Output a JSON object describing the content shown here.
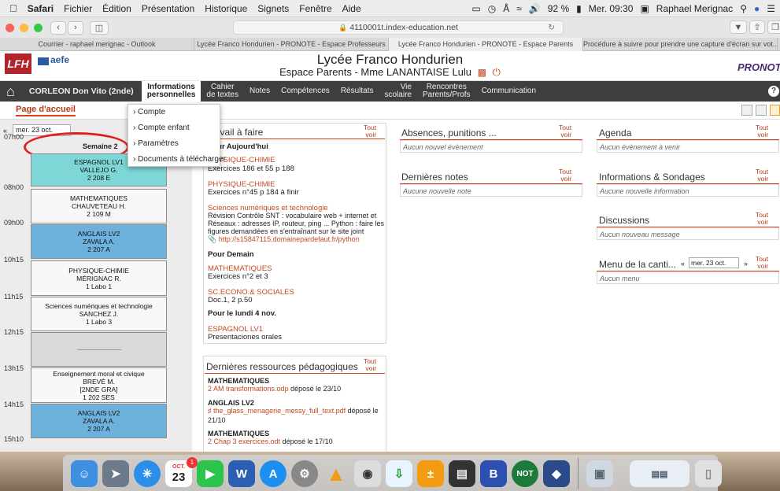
{
  "menubar": {
    "items": [
      "Safari",
      "Fichier",
      "Édition",
      "Présentation",
      "Historique",
      "Signets",
      "Fenêtre",
      "Aide"
    ],
    "battery": "92 %",
    "clock": "Mer. 09:30",
    "user": "Raphael Merignac"
  },
  "browser": {
    "url": "4110001t.index-education.net",
    "tabs": [
      "Courrier - raphael merignac - Outlook",
      "Lycée Franco Hondurien - PRONOTE - Espace Professeurs",
      "Lycée Franco Hondurien - PRONOTE - Espace Parents",
      "Procédure à suivre pour prendre une capture d'écran sur vot..."
    ]
  },
  "header": {
    "school": "Lycée Franco Hondurien",
    "space": "Espace Parents - Mme LANANTAISE Lulu",
    "logo_text": "aefe",
    "brand": "PRONOTE"
  },
  "nav": {
    "student": "CORLEON Don Vito (2nde)",
    "items": [
      [
        "Informations",
        "personnelles"
      ],
      [
        "Cahier",
        "de textes"
      ],
      [
        "Notes",
        ""
      ],
      [
        "Compétences",
        ""
      ],
      [
        "Résultats",
        ""
      ],
      [
        "Vie",
        "scolaire"
      ],
      [
        "Rencontres",
        "Parents/Profs"
      ],
      [
        "Communication",
        ""
      ]
    ]
  },
  "page_tab": "Page d'accueil",
  "dropdown": [
    "Compte",
    "Compte enfant",
    "Paramètres",
    "Documents à télécharger"
  ],
  "schedule": {
    "date": "mer. 23 oct.",
    "week": "Semaine 2",
    "times": [
      "07h00",
      "08h00",
      "09h00",
      "10h15",
      "11h15",
      "12h15",
      "13h15",
      "14h15",
      "15h10"
    ],
    "courses": [
      {
        "l1": "ESPAGNOL LV1",
        "l2": "VALLEJO G.",
        "l3": "2 208 E",
        "l4": "",
        "color": "teal"
      },
      {
        "l1": "MATHEMATIQUES",
        "l2": "CHAUVETEAU H.",
        "l3": "2 109 M",
        "l4": "",
        "color": "white"
      },
      {
        "l1": "ANGLAIS LV2",
        "l2": "ZAVALA A.",
        "l3": "2 207 A",
        "l4": "",
        "color": "blue"
      },
      {
        "l1": "PHYSIQUE-CHIMIE",
        "l2": "MÉRIGNAC R.",
        "l3": "1 Labo 1",
        "l4": "",
        "color": "white"
      },
      {
        "l1": "Sciences numériques et technologie",
        "l2": "SANCHEZ J.",
        "l3": "1 Labo 3",
        "l4": "",
        "color": "white"
      },
      {
        "l1": "Enseignement moral et civique",
        "l2": "BREVÉ M.",
        "l3": "[2NDE GRA]",
        "l4": "1 202 SES",
        "color": "white"
      },
      {
        "l1": "ANGLAIS LV2",
        "l2": "ZAVALA A.",
        "l3": "2 207 A",
        "l4": "",
        "color": "blue"
      }
    ]
  },
  "travail": {
    "title": "Travail à faire",
    "tout": [
      "Tout",
      "voir"
    ],
    "h_today": "Pour Aujourd'hui",
    "e1_subject": "PHYSIQUE-CHIMIE",
    "e1_text": "Exercices 186 et 55 p 188",
    "e2_subject": "PHYSIQUE-CHIMIE",
    "e2_text": "Exercices n°45 p 184 à finir",
    "e3_subject": "Sciences numériques et technologie",
    "e3_lines": [
      "Révision Contrôle SNT : vocabulaire web + internet et",
      "Réseaux : adresses IP, routeur, ping ... Python : faire les",
      "figures demandées en s'entraînant sur le site joint"
    ],
    "e3_link": "http://s15847115.domainepardefaut.fr/python",
    "h_demain": "Pour Demain",
    "e4_subject": "MATHEMATIQUES",
    "e4_text": "Exercices n°2 et 3",
    "e5_subject": "SC.ECONO.& SOCIALES",
    "e5_text": "Doc.1, 2 p.50",
    "h_lundi": "Pour le lundi 4 nov.",
    "e6_subject": "ESPAGNOL LV1",
    "e6_text": "Presentaciones orales"
  },
  "ressources": {
    "title": "Dernières ressources pédagogiques",
    "r1_subject": "MATHEMATIQUES",
    "r1_file": "2 AM transformations.odp",
    "r1_date": " déposé le 23/10",
    "r2_subject": "ANGLAIS LV2",
    "r2_file": "the_glass_menagerie_messy_full_text.pdf",
    "r2_date": " déposé le",
    "r2_date2": "21/10",
    "r3_subject": "MATHEMATIQUES",
    "r3_file": "2 Chap 3 exercices.odt",
    "r3_date": " déposé le 17/10"
  },
  "absences": {
    "title": "Absences, punitions ...",
    "empty": "Aucun nouvel évènement"
  },
  "notes": {
    "title": "Dernières notes",
    "empty": "Aucune nouvelle note"
  },
  "agenda": {
    "title": "Agenda",
    "empty": "Aucun évènement à venir"
  },
  "infos": {
    "title": "Informations & Sondages",
    "empty": "Aucune nouvelle information"
  },
  "discussions": {
    "title": "Discussions",
    "empty": "Aucun nouveau message"
  },
  "menu": {
    "title": "Menu de la canti...",
    "date": "mer. 23 oct.",
    "empty": "Aucun menu"
  },
  "dock": {
    "calendar_month": "OCT.",
    "calendar_day": "23",
    "badge": "1"
  }
}
